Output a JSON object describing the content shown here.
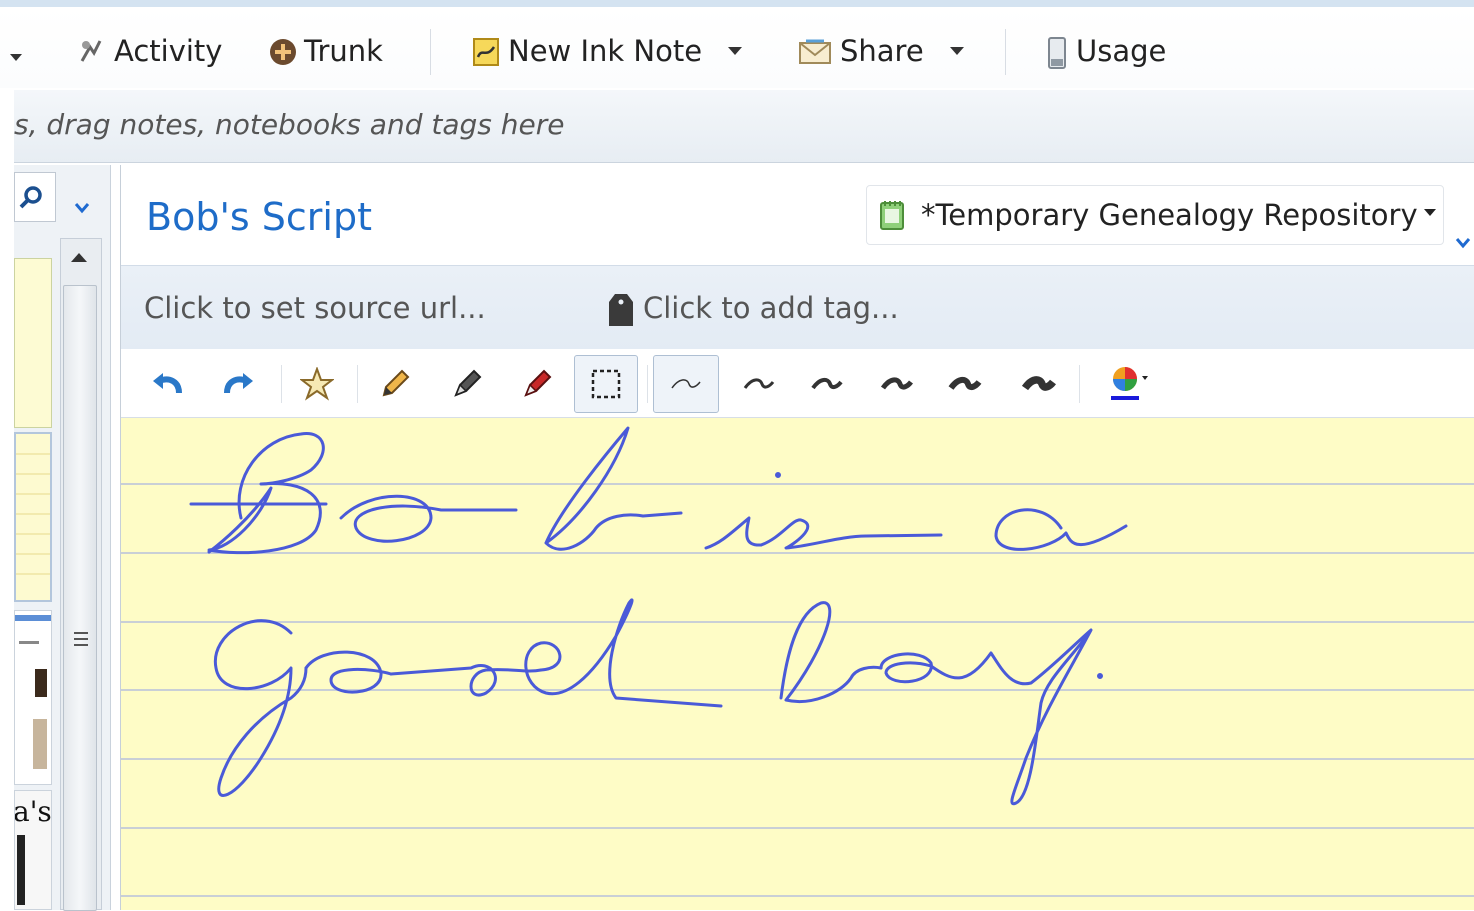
{
  "toolbar": {
    "items": [
      {
        "label": "Activity",
        "icon": "activity-icon"
      },
      {
        "label": "Trunk",
        "icon": "trunk-icon"
      },
      {
        "label": "New Ink Note",
        "icon": "ink-note-icon"
      },
      {
        "label": "Share",
        "icon": "share-icon"
      },
      {
        "label": "Usage",
        "icon": "usage-icon"
      }
    ]
  },
  "shortcuts": {
    "hint": "s, drag notes, notebooks and tags here"
  },
  "note": {
    "title": "Bob's Script",
    "notebook": "*Temporary Genealogy Repository",
    "source_url_placeholder": "Click to set source url...",
    "tag_placeholder": "Click to add tag..."
  },
  "ink_tools": [
    "undo-icon",
    "redo-icon",
    "highlight-star-icon",
    "pencil-icon",
    "pen-icon",
    "marker-icon",
    "selection-icon",
    "stroke-width-1",
    "stroke-width-2",
    "stroke-width-3",
    "stroke-width-4",
    "stroke-width-5",
    "stroke-width-6",
    "color-picker-icon"
  ],
  "colors": {
    "ink": "#4a5ad8",
    "paper": "#fefcc6",
    "rule": "#c9cfd6",
    "title": "#1e6cc8"
  },
  "left_pane": {
    "snippet_text": "a's"
  }
}
